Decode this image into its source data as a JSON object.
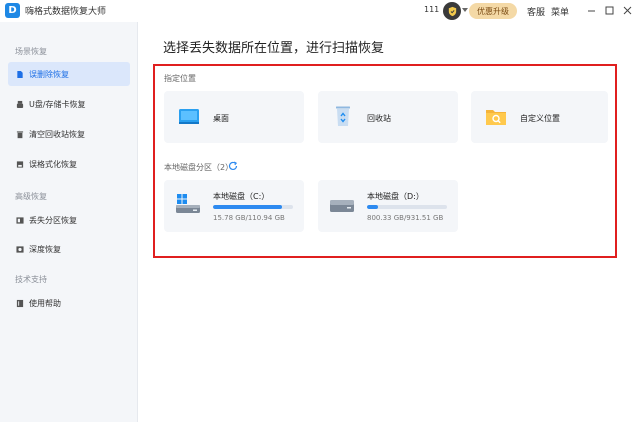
{
  "app": {
    "title": "嗨格式数据恢复大师",
    "logo_letter": "D",
    "user_id": "111",
    "upgrade_label": "优惠升级",
    "support_label": "客服",
    "menu_label": "菜单",
    "accent": "#1d6fe6"
  },
  "sidebar": {
    "sections": [
      {
        "title": "场景恢复",
        "items": [
          {
            "label": "误删除恢复",
            "icon": "file-icon",
            "active": true
          },
          {
            "label": "U盘/存储卡恢复",
            "icon": "usb-icon",
            "active": false
          },
          {
            "label": "清空回收站恢复",
            "icon": "trash-icon",
            "active": false
          },
          {
            "label": "误格式化恢复",
            "icon": "disk-format-icon",
            "active": false
          }
        ]
      },
      {
        "title": "高级恢复",
        "items": [
          {
            "label": "丢失分区恢复",
            "icon": "partition-icon",
            "active": false
          },
          {
            "label": "深度恢复",
            "icon": "deep-scan-icon",
            "active": false
          }
        ]
      },
      {
        "title": "技术支持",
        "items": [
          {
            "label": "使用帮助",
            "icon": "help-book-icon",
            "active": false
          }
        ]
      }
    ]
  },
  "main": {
    "title": "选择丢失数据所在位置，进行扫描恢复",
    "locations": {
      "label": "指定位置",
      "items": [
        {
          "label": "桌面",
          "icon": "desktop-icon"
        },
        {
          "label": "回收站",
          "icon": "recycle-bin-icon"
        },
        {
          "label": "自定义位置",
          "icon": "folder-search-icon"
        }
      ]
    },
    "disks": {
      "label": "本地磁盘分区（2）",
      "items": [
        {
          "name": "本地磁盘（C:）",
          "size": "15.78 GB/110.94 GB",
          "used_fraction": 0.86,
          "icon": "windows-drive-icon"
        },
        {
          "name": "本地磁盘（D:）",
          "size": "800.33 GB/931.51 GB",
          "used_fraction": 0.14,
          "icon": "drive-icon"
        }
      ]
    }
  }
}
